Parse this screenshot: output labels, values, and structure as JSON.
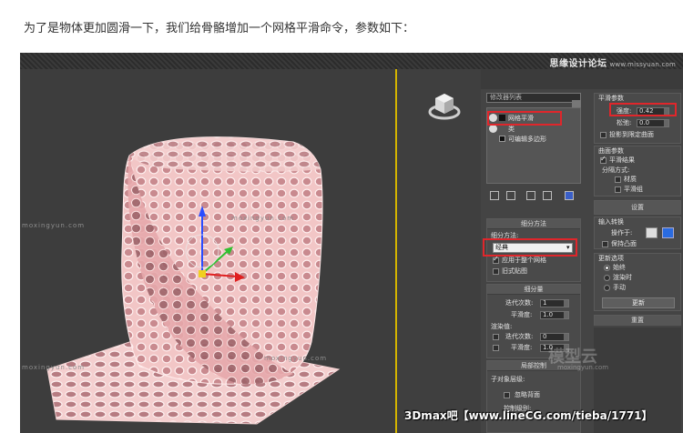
{
  "intro_text": "为了是物体更加圆滑一下，我们给骨骼增加一个网格平滑命令，参数如下：",
  "forum_logo": {
    "cn": "思缘设计论坛",
    "url": "www.missyuan.com"
  },
  "watermarks": {
    "moxing": "moxingyun.com",
    "big": "模型云",
    "big_sub": "moxingyun.com"
  },
  "caption": "3Dmax吧【www.lineCG.com/tieba/1771】",
  "modifier_list": {
    "label": "修改器列表"
  },
  "stack": {
    "items": [
      "网格平滑",
      "类",
      "可编辑多边形"
    ]
  },
  "subdivision_method": {
    "title": "细分方法",
    "label": "细分方法:",
    "value": "经典",
    "apply_whole": "应用于整个网格",
    "old_map": "旧式贴图"
  },
  "subdivision_amount": {
    "title": "细分量",
    "iterations_label": "迭代次数:",
    "iterations_value": "1",
    "smoothness_label": "平滑度:",
    "smoothness_value": "1.0",
    "render_label": "渲染值:",
    "render_iterations_label": "迭代次数:",
    "render_iterations_value": "0",
    "render_smoothness_label": "平滑度:",
    "render_smoothness_value": "1.0"
  },
  "local_control": {
    "title": "局部控制",
    "sublevel_label": "子对象层级:",
    "ignore_back": "忽略背面",
    "control_level": "控制级别:"
  },
  "smoothing_params": {
    "title": "平滑参数",
    "strength_label": "强度:",
    "strength_value": "0.42",
    "relax_label": "松弛:",
    "relax_value": "0.0",
    "project_limit": "投影到限定曲面"
  },
  "surface_params": {
    "title": "曲面参数",
    "smooth_result": "平滑结果",
    "separate_label": "分隔方式:",
    "by_material": "材质",
    "by_smoothing_group": "平滑组"
  },
  "settings": {
    "title": "设置",
    "input_conversion": "输入转换",
    "operate_on": "操作于:",
    "keep_convex": "保持凸面"
  },
  "update_options": {
    "title": "更新选项",
    "always": "始终",
    "when_rendering": "渲染时",
    "manual": "手动",
    "update_btn": "更新"
  },
  "reset": {
    "title": "重置"
  },
  "colors": {
    "highlight": "#e0262b",
    "viewport_border": "#d4b400",
    "mesh": "#e9b3b4"
  }
}
